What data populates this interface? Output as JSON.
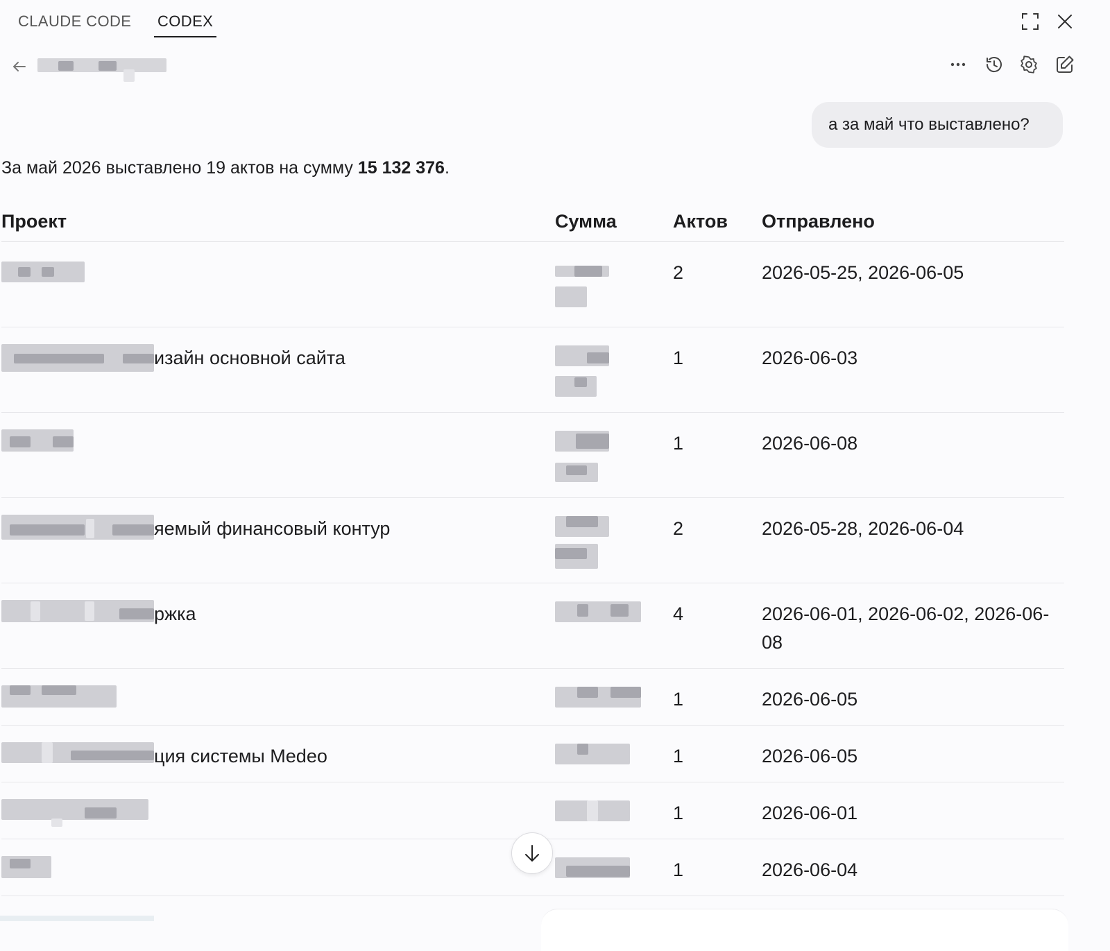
{
  "tabs": [
    {
      "label": "CLAUDE CODE",
      "active": false
    },
    {
      "label": "CODEX",
      "active": true
    }
  ],
  "header": {
    "title": "",
    "icons": [
      "back-arrow-icon",
      "more-icon",
      "history-icon",
      "settings-icon",
      "new-chat-icon"
    ]
  },
  "window_icons": [
    "expand-icon",
    "close-icon"
  ],
  "conversation": {
    "user_message": "а за май что выставлено?",
    "summary_prefix": "За май 2026 выставлено 19 актов на сумму ",
    "summary_amount": "15 132 376",
    "summary_suffix": "."
  },
  "table": {
    "headers": {
      "project": "Проект",
      "sum": "Сумма",
      "count": "Актов",
      "sent": "Отправлено"
    },
    "rows": [
      {
        "project_visible": "",
        "sum": "",
        "count": "2",
        "sent": "2026-05-25, 2026-06-05"
      },
      {
        "project_visible": "изайн основной сайта",
        "sum": "",
        "count": "1",
        "sent": "2026-06-03"
      },
      {
        "project_visible": "",
        "sum": "",
        "count": "1",
        "sent": "2026-06-08"
      },
      {
        "project_visible": "яемый финансовый контур",
        "sum": "",
        "count": "2",
        "sent": "2026-05-28, 2026-06-04"
      },
      {
        "project_visible": "ржка",
        "sum": "",
        "count": "4",
        "sent": "2026-06-01, 2026-06-02, 2026-06-08"
      },
      {
        "project_visible": "",
        "sum": "",
        "count": "1",
        "sent": "2026-06-05"
      },
      {
        "project_visible": "ция системы Medeo",
        "sum": "",
        "count": "1",
        "sent": "2026-06-05"
      },
      {
        "project_visible": "",
        "sum": "",
        "count": "1",
        "sent": "2026-06-01"
      },
      {
        "project_visible": "",
        "sum": "",
        "count": "1",
        "sent": "2026-06-04"
      }
    ]
  },
  "colors": {
    "background": "#fbfbfd",
    "bubble": "#ededf0",
    "text": "#1d1d1f",
    "redaction": "#cfcfd4"
  }
}
